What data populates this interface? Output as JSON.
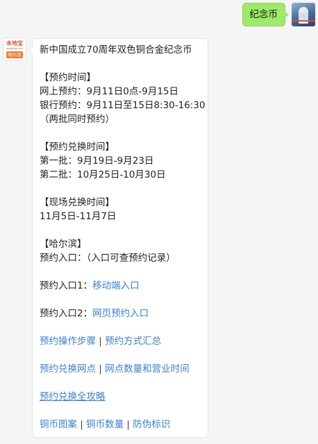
{
  "outgoing": {
    "text": "纪念币"
  },
  "brand": {
    "logo": "本地宝",
    "site": "bendibao.com",
    "city": "哈尔滨"
  },
  "message": {
    "title": "新中国成立70周年双色铜合金纪念币",
    "booking": {
      "heading": "【预约时间】",
      "online": "网上预约：9月11日0点-9月15日",
      "bank": "银行预约：9月11日至15日8:30-16:30",
      "note": "（两批同时预约）"
    },
    "exchange": {
      "heading": "【预约兑换时间】",
      "batch1": "第一批：9月19日-9月23日",
      "batch2": "第二批：10月25日-10月30日"
    },
    "onsite": {
      "heading": "【现场兑换时间】",
      "dates": "11月5日-11月7日"
    },
    "harbin": {
      "heading": "【哈尔滨】",
      "entry_label": "预约入口：（入口可查预约记录）",
      "entry1_label": "预约入口1：",
      "entry1_link": "移动端入口",
      "entry2_label": "预约入口2：",
      "entry2_link": "网页预约入口"
    },
    "links": {
      "steps": "预约操作步骤",
      "methods": "预约方式汇总",
      "outlets": "预约兑换网点",
      "outlet_hours": "网点数量和营业时间",
      "guide": "预约兑换全攻略",
      "design": "铜币图案",
      "quantity": "铜币数量",
      "anti_fake": "防伪标识",
      "separator": " | "
    }
  }
}
